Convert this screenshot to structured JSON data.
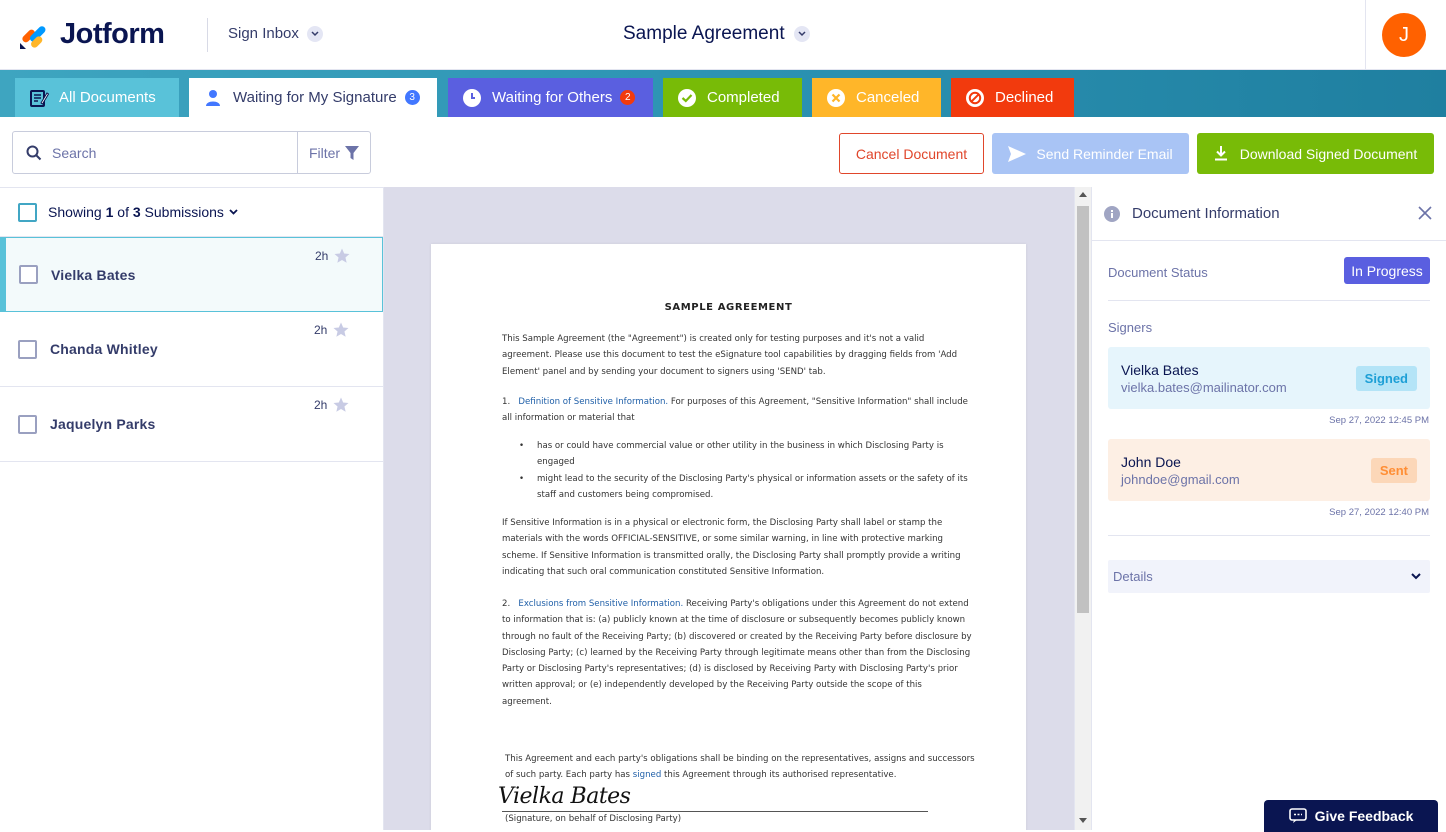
{
  "header": {
    "brand": "Jotform",
    "inbox_label": "Sign Inbox",
    "document_title": "Sample Agreement",
    "avatar_initial": "J",
    "colors": {
      "avatar": "#ff6100",
      "brand_navy": "#0a1551"
    }
  },
  "tabs": [
    {
      "label": "All Documents",
      "icon": "document-edit-icon",
      "badge": null,
      "color": "#59c2d9"
    },
    {
      "label": "Waiting for My Signature",
      "icon": "user-icon",
      "badge": "3",
      "color": "#ffffff"
    },
    {
      "label": "Waiting for Others",
      "icon": "clock-icon",
      "badge": "2",
      "color": "#5a5fe0"
    },
    {
      "label": "Completed",
      "icon": "check-circle-icon",
      "badge": null,
      "color": "#78bb07"
    },
    {
      "label": "Canceled",
      "icon": "x-circle-icon",
      "badge": null,
      "color": "#ffb629"
    },
    {
      "label": "Declined",
      "icon": "ban-icon",
      "badge": null,
      "color": "#f23a0d"
    }
  ],
  "toolbar": {
    "search_placeholder": "Search",
    "filter_label": "Filter",
    "cancel_label": "Cancel Document",
    "reminder_label": "Send Reminder Email",
    "download_label": "Download Signed Document"
  },
  "list": {
    "showing_prefix": "Showing ",
    "showing_current": "1",
    "showing_of": " of ",
    "showing_total": "3",
    "showing_suffix": " Submissions",
    "items": [
      {
        "name": "Vielka Bates",
        "time": "2h",
        "active": true
      },
      {
        "name": "Chanda Whitley",
        "time": "2h",
        "active": false
      },
      {
        "name": "Jaquelyn Parks",
        "time": "2h",
        "active": false
      }
    ]
  },
  "document": {
    "title": "SAMPLE AGREEMENT",
    "intro": "This Sample Agreement (the \"Agreement\") is created only for testing purposes and it's not a valid agreement. Please use this document to test the eSignature tool capabilities by dragging fields from 'Add Element' panel and by sending your document to signers using 'SEND' tab.",
    "s1_num": "1.",
    "s1_link": "Definition of Sensitive Information.",
    "s1_text": " For purposes of this Agreement, \"Sensitive Information\" shall include all information or material that",
    "bullet_1": "has or could have commercial value or other utility in the business in which Disclosing Party is engaged",
    "bullet_2": "might lead to the security of the Disclosing Party's physical or information assets  or the safety of its staff and customers  being compromised.",
    "p_sensitive": "If Sensitive Information is in a physical or electronic form, the Disclosing Party shall label or stamp the materials with the words OFFICIAL-SENSITIVE, or some similar warning, in line with protective marking scheme. If Sensitive Information is transmitted orally, the Disclosing Party shall promptly provide a writing indicating that such oral communication constituted Sensitive Information.",
    "s2_num": "2.",
    "s2_link": "Exclusions from Sensitive Information.",
    "s2_text": " Receiving Party's obligations under this Agreement do not extend to information that is: (a) publicly known at the time of disclosure or subsequently becomes publicly known through no fault of the Receiving Party; (b) discovered or created by the Receiving Party before disclosure by Disclosing Party; (c) learned by the Receiving Party through legitimate means other than from the Disclosing Party or Disclosing Party's representatives; (d) is disclosed by Receiving Party with Disclosing Party's prior written approval; or (e) independently developed by the Receiving Party outside the scope of this agreement.",
    "closing_a": "This Agreement and each party's obligations shall be binding on the representatives, assigns and successors of such party. Each party has ",
    "closing_link": "signed",
    "closing_b": " this Agreement through its authorised representative.",
    "signature": "Vielka Bates",
    "sig_caption": "(Signature, on behalf of Disclosing Party)"
  },
  "info": {
    "title": "Document Information",
    "status_label": "Document Status",
    "status_value": "In Progress",
    "signers_label": "Signers",
    "signers": [
      {
        "name": "Vielka Bates",
        "email": "vielka.bates@mailinator.com",
        "status": "Signed",
        "date": "Sep 27, 2022 12:45 PM"
      },
      {
        "name": "John Doe",
        "email": "johndoe@gmail.com",
        "status": "Sent",
        "date": "Sep 27, 2022 12:40 PM"
      }
    ],
    "details_label": "Details"
  },
  "feedback_label": "Give Feedback"
}
